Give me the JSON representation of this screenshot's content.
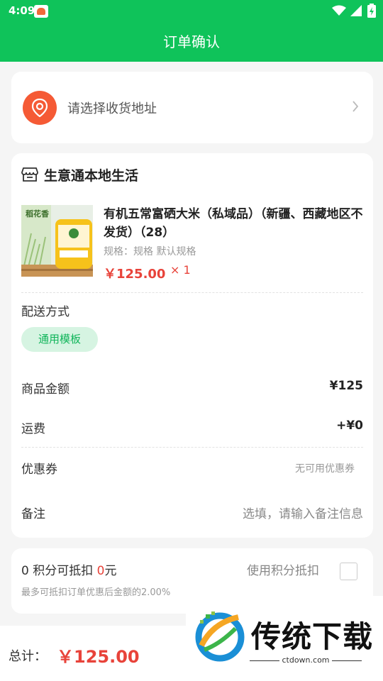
{
  "status_bar": {
    "time": "4:09"
  },
  "header": {
    "title": "订单确认"
  },
  "address": {
    "placeholder": "请选择收货地址"
  },
  "shop": {
    "name": "生意通本地生活"
  },
  "product": {
    "title": "有机五常富硒大米（私域品）（新疆、西藏地区不发货）（28）",
    "spec": "规格：规格 默认规格",
    "price": "￥125.00",
    "quantity": "× 1",
    "image_text": "稻花香"
  },
  "delivery": {
    "label": "配送方式",
    "option": "通用模板"
  },
  "summary": {
    "goods_label": "商品金额",
    "goods_value": "¥125",
    "shipping_label": "运费",
    "shipping_value": "+¥0",
    "coupon_label": "优惠券",
    "coupon_value": "无可用优惠券",
    "remark_label": "备注",
    "remark_placeholder": "选填，请输入备注信息"
  },
  "points": {
    "count": "0",
    "text_mid": " 积分可抵扣 ",
    "amount": "0",
    "unit": "元",
    "use_label": "使用积分抵扣",
    "note": "最多可抵扣订单优惠后金额的2.00%"
  },
  "footer": {
    "total_label": "总计：",
    "total_value": "￥125.00"
  },
  "watermark": {
    "title": "传统下载",
    "subtitle": "ctdown.com"
  },
  "colors": {
    "brand_green": "#0fc35a",
    "price_red": "#e8433a",
    "chip_bg": "#d6f4e2"
  }
}
